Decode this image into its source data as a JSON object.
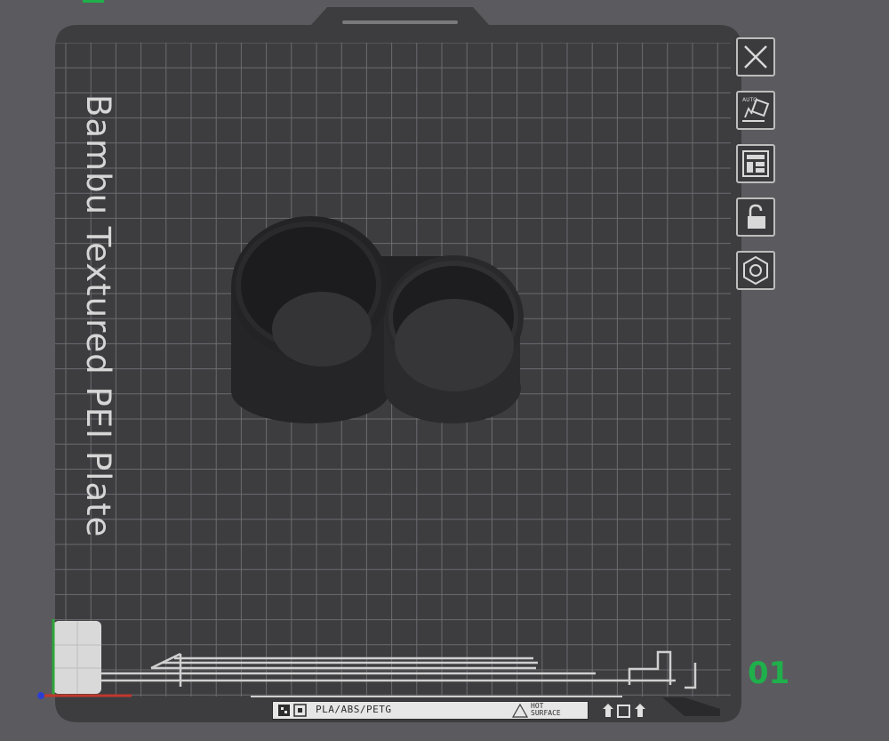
{
  "plate": {
    "title": "Bambu Textured PEI Plate",
    "number": "01",
    "material_label": "PLA/ABS/PETG",
    "hot_surface_line1": "HOT",
    "hot_surface_line2": "SURFACE"
  },
  "toolbar": {
    "buttons": [
      {
        "name": "close",
        "icon": "close-icon"
      },
      {
        "name": "auto-orient",
        "icon": "auto-orient-icon",
        "badge": "AUTO"
      },
      {
        "name": "arrange",
        "icon": "arrange-layout-icon"
      },
      {
        "name": "lock",
        "icon": "unlocked-padlock-icon"
      },
      {
        "name": "settings",
        "icon": "hexagon-nut-icon"
      }
    ]
  },
  "colors": {
    "background": "#5b5b5f",
    "plate": "#3d3d40",
    "grid": "#6c6c70",
    "accent_green": "#1fb04b",
    "model": "#262628"
  }
}
